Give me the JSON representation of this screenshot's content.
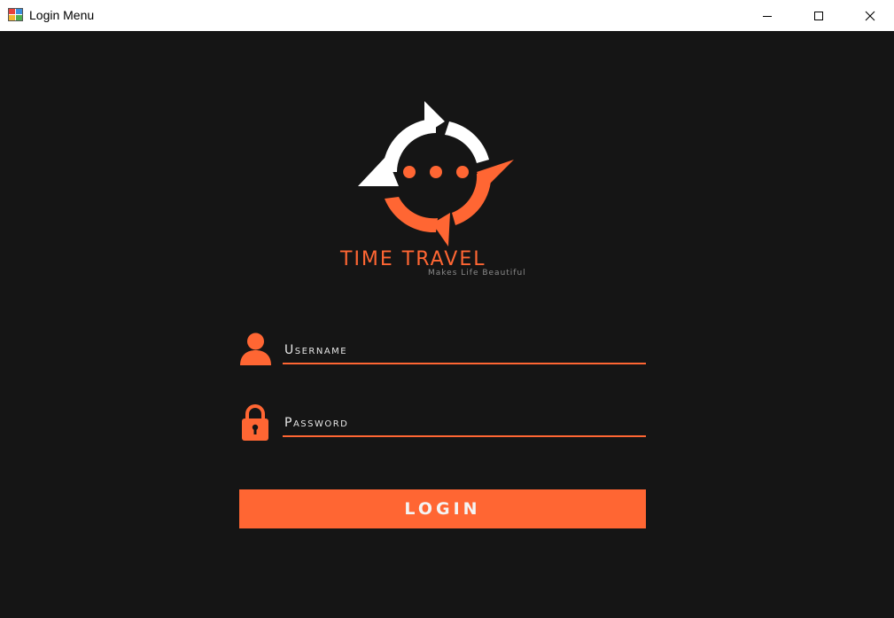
{
  "window": {
    "title": "Login Menu",
    "controls": {
      "minimize_icon": "minimize-icon",
      "maximize_icon": "maximize-icon",
      "close_icon": "close-icon"
    }
  },
  "branding": {
    "name": "TIME TRAVEL",
    "tagline": "Makes Life Beautiful",
    "logo_icon": "compass-chat-logo"
  },
  "form": {
    "username": {
      "placeholder": "Username",
      "value": "",
      "icon": "user-icon"
    },
    "password": {
      "placeholder": "Password",
      "value": "",
      "icon": "lock-icon"
    },
    "login_label": "LOGIN"
  },
  "colors": {
    "background": "#151515",
    "accent": "#ff6633",
    "titlebar": "#ffffff",
    "text_light": "#e6e6e6",
    "tagline": "#8a8a8a"
  }
}
